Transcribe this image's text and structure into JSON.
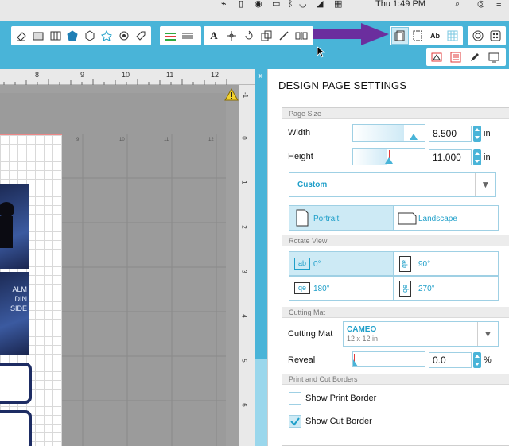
{
  "menubar": {
    "clock": "Thu 1:49 PM"
  },
  "toolbar": {
    "row1_left": [
      "eraser-icon",
      "rectangle-icon",
      "grid-rect-icon",
      "pentagon-icon",
      "hexagon-icon",
      "star-icon",
      "badge-icon",
      "tag-icon",
      "lines-green-icon",
      "lines-double-icon",
      "text-icon",
      "move-icon",
      "rotate-icon",
      "replicate-icon",
      "knife-icon",
      "align-icon"
    ],
    "row1_right": [
      "page-setup-icon",
      "cut-border-icon",
      "text-style-icon",
      "grid-icon"
    ],
    "row1_far": [
      "circle-target-icon",
      "dots-icon"
    ],
    "row2": [
      "send-icon",
      "library-icon",
      "pen-icon",
      "store-icon"
    ],
    "text_btn": "A",
    "ab_btn": "Ab"
  },
  "ruler": {
    "h_ticks": [
      "8",
      "9",
      "10",
      "11",
      "12"
    ],
    "v_ticks": [
      "-1",
      "0",
      "1",
      "2",
      "3",
      "4",
      "5",
      "6"
    ],
    "mat_ticks": [
      "9",
      "10",
      "11",
      "12"
    ]
  },
  "design_tiles": {
    "tile2_lines": [
      "ALM",
      "DIN",
      "",
      "SIDE"
    ]
  },
  "panel": {
    "title": "DESIGN PAGE SETTINGS",
    "page_size": {
      "header": "Page Size",
      "width_label": "Width",
      "width_value": "8.500",
      "height_label": "Height",
      "height_value": "11.000",
      "unit": "in",
      "preset": "Custom",
      "portrait": "Portrait",
      "landscape": "Landscape",
      "width_slider": 0.71,
      "height_slider": 0.48
    },
    "rotate_view": {
      "header": "Rotate View",
      "options": [
        "0°",
        "90°",
        "180°",
        "270°"
      ],
      "icons": [
        "ab",
        "ab",
        "qe",
        "qe"
      ]
    },
    "cutting_mat": {
      "header": "Cutting Mat",
      "label": "Cutting Mat",
      "value": "CAMEO",
      "sub": "12 x 12 in",
      "reveal_label": "Reveal",
      "reveal_value": "0.0",
      "reveal_unit": "%"
    },
    "borders": {
      "header": "Print and Cut Borders",
      "print_border": "Show Print Border",
      "cut_border": "Show Cut Border",
      "print_checked": false,
      "cut_checked": true
    }
  },
  "colors": {
    "accent": "#49b4d8",
    "arrow": "#6b2e9e",
    "warn": "#f2d230"
  }
}
